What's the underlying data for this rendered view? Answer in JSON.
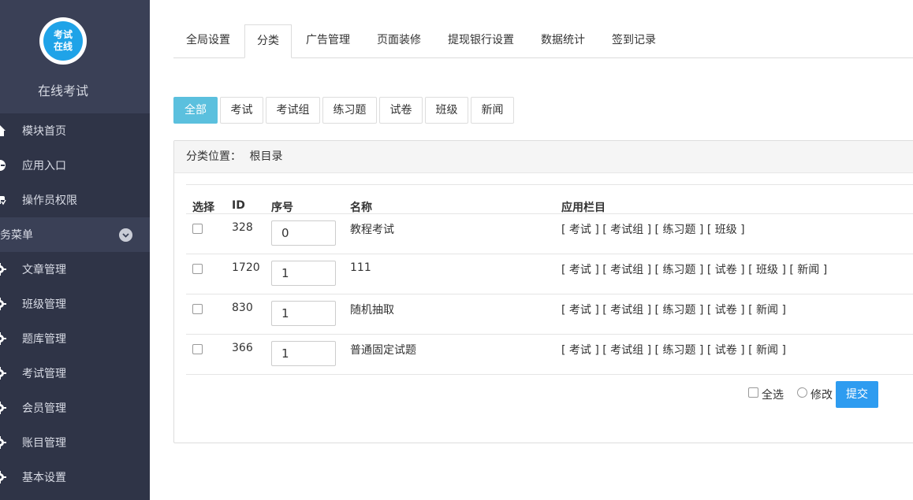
{
  "sidebar": {
    "logo_text_line1": "考试",
    "logo_text_line2": "在线",
    "title": "在线考试",
    "top_items": [
      {
        "label": "模块首页",
        "icon": "home-icon"
      },
      {
        "label": "应用入口",
        "icon": "entry-icon"
      },
      {
        "label": "操作员权限",
        "icon": "permission-icon"
      }
    ],
    "section_label": "业务菜单",
    "section_label_visible": "务菜单",
    "business_items": [
      {
        "label": "文章管理",
        "icon": "gear-icon"
      },
      {
        "label": "班级管理",
        "icon": "gear-icon"
      },
      {
        "label": "题库管理",
        "icon": "gear-icon"
      },
      {
        "label": "考试管理",
        "icon": "gear-icon"
      },
      {
        "label": "会员管理",
        "icon": "gear-icon"
      },
      {
        "label": "账目管理",
        "icon": "gear-icon"
      },
      {
        "label": "基本设置",
        "icon": "gear-icon"
      }
    ]
  },
  "tabs": [
    "全局设置",
    "分类",
    "广告管理",
    "页面装修",
    "提现银行设置",
    "数据统计",
    "签到记录"
  ],
  "active_tab": "分类",
  "filters": [
    "全部",
    "考试",
    "考试组",
    "练习题",
    "试卷",
    "班级",
    "新闻"
  ],
  "active_filter": "全部",
  "panel": {
    "location_label": "分类位置：",
    "location_value": "根目录"
  },
  "table": {
    "headers": {
      "select": "选择",
      "id": "ID",
      "order": "序号",
      "name": "名称",
      "columns": "应用栏目"
    },
    "rows": [
      {
        "id": "328",
        "order": "0",
        "name": "教程考试",
        "columns": "[ 考试 ] [ 考试组 ] [ 练习题 ] [ 班级 ]"
      },
      {
        "id": "1720",
        "order": "1",
        "name": "111",
        "columns": "[ 考试 ] [ 考试组 ] [ 练习题 ] [ 试卷 ] [ 班级 ] [ 新闻 ]"
      },
      {
        "id": "830",
        "order": "1",
        "name": "随机抽取",
        "columns": "[ 考试 ] [ 考试组 ] [ 练习题 ] [ 试卷 ] [ 新闻 ]"
      },
      {
        "id": "366",
        "order": "1",
        "name": "普通固定试题",
        "columns": "[ 考试 ] [ 考试组 ] [ 练习题 ] [ 试卷 ] [ 新闻 ]"
      }
    ]
  },
  "footer": {
    "select_all_label": "全选",
    "modify_label": "修改",
    "submit_label": "提交"
  },
  "colors": {
    "sidebar_bg": "#2f3447",
    "sidebar_header_bg": "#3a4056",
    "active_filter": "#5bc0de",
    "submit": "#2e9cf0"
  }
}
